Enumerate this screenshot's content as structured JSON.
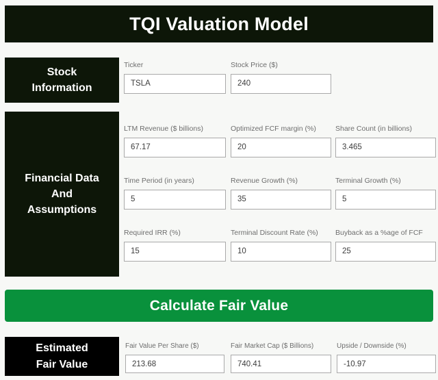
{
  "app": {
    "title": "TQI Valuation Model",
    "background_color": "#f7f8f6",
    "panel_color": "#0d1608",
    "accent_color": "#09913c",
    "result_panel_color": "#000000"
  },
  "sections": {
    "stock": {
      "panel_label": "Stock\nInformation",
      "fields": [
        {
          "label": "Ticker",
          "value": "TSLA",
          "placeholder": "Ticker"
        },
        {
          "label": "Stock Price ($)",
          "value": "240",
          "placeholder": "Stock Price"
        }
      ]
    },
    "financial": {
      "panel_label": "Financial Data\nAnd\nAssumptions",
      "fields": [
        {
          "label": "LTM Revenue ($ billions)",
          "value": "67.17",
          "placeholder": "LTM Revenue"
        },
        {
          "label": "Optimized FCF margin (%)",
          "value": "20",
          "placeholder": "FCF margin"
        },
        {
          "label": "Share Count (in billions)",
          "value": "3.465",
          "placeholder": "Share Count"
        },
        {
          "label": "Time Period (in years)",
          "value": "5",
          "placeholder": "Time Period"
        },
        {
          "label": "Revenue Growth (%)",
          "value": "35",
          "placeholder": "Revenue Growth"
        },
        {
          "label": "Terminal Growth (%)",
          "value": "5",
          "placeholder": "Terminal Growth"
        },
        {
          "label": "Required IRR (%)",
          "value": "15",
          "placeholder": "Required IRR"
        },
        {
          "label": "Terminal Discount Rate (%)",
          "value": "10",
          "placeholder": "Discount Rate"
        },
        {
          "label": "Buyback as a %age of FCF",
          "value": "25",
          "placeholder": "Buyback %"
        }
      ]
    },
    "estimated": {
      "panel_label": "Estimated\nFair Value",
      "fields": [
        {
          "label": "Fair Value Per Share ($)",
          "value": "213.68",
          "placeholder": "Fair Value Per Share"
        },
        {
          "label": "Fair Market Cap ($ Billions)",
          "value": "740.41",
          "placeholder": "Fair Market Cap"
        },
        {
          "label": "Upside / Downside (%)",
          "value": "-10.97",
          "placeholder": "Upside / Downside"
        }
      ]
    }
  },
  "calculate_button": {
    "label": "Calculate Fair Value"
  }
}
